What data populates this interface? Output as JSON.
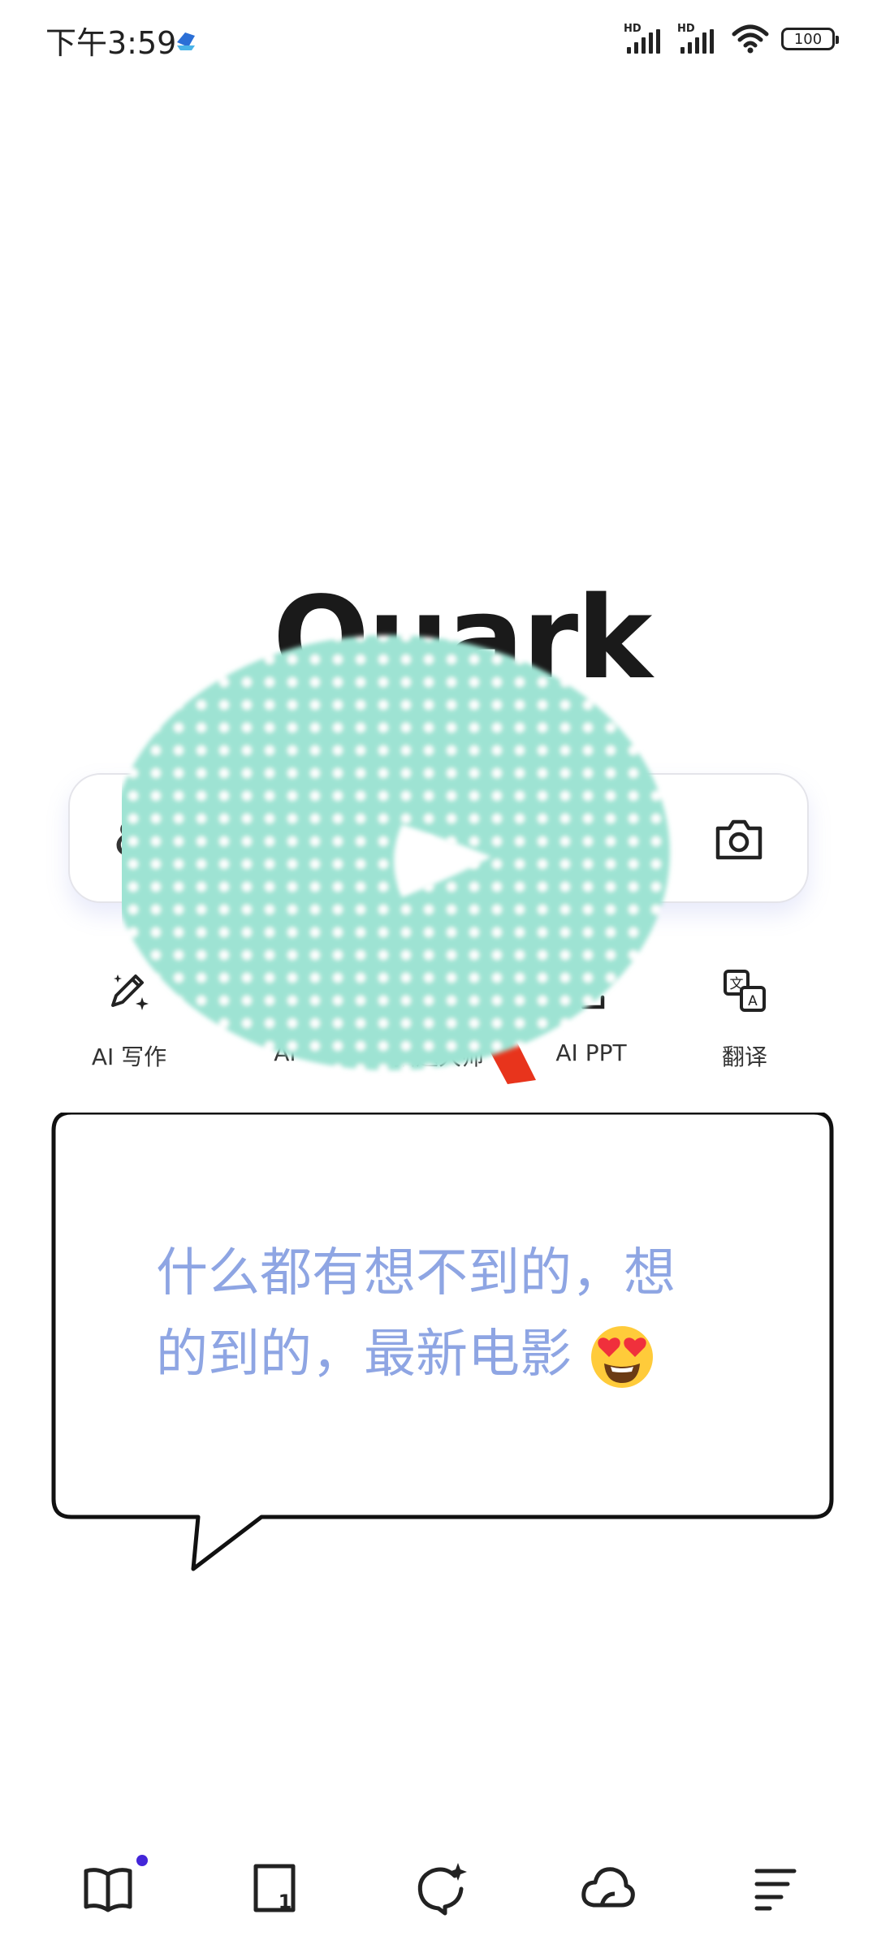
{
  "status_bar": {
    "time": "下午3:59",
    "signal_1_label": "HD",
    "signal_2_label": "HD",
    "battery": "100"
  },
  "logo": {
    "text": "Quark"
  },
  "search": {
    "left_icon": "link-icon",
    "right_icon": "camera-icon"
  },
  "shortcuts": [
    {
      "label": "AI 写作",
      "icon": "pen-sparkle-icon"
    },
    {
      "label": "AI",
      "icon": "hidden-icon"
    },
    {
      "label": "拍题大师",
      "icon": "hidden-icon"
    },
    {
      "label": "AI PPT",
      "icon": "ppt-icon"
    },
    {
      "label": "翻译",
      "icon": "translate-icon"
    }
  ],
  "bubble": {
    "text_line1": "什么都有想不到的，想",
    "text_line2": "的到的，最新电影",
    "emoji": "heart-eyes-emoji"
  },
  "bottom_nav": [
    {
      "icon": "book-icon",
      "has_dot": true
    },
    {
      "icon": "tab-count-icon",
      "label": "1"
    },
    {
      "icon": "ai-chat-icon"
    },
    {
      "icon": "cloud-icon"
    },
    {
      "icon": "menu-icon"
    }
  ],
  "colors": {
    "sticker_teal": "#9ee3d3",
    "bubble_text": "#8ea5e3",
    "badge": "#4326d9",
    "accent_red": "#e8341c"
  }
}
